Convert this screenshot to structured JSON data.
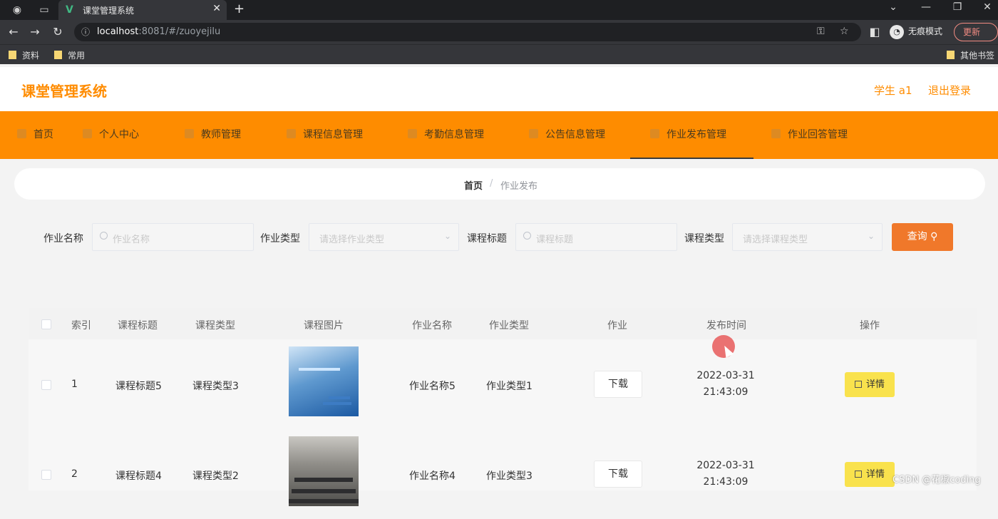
{
  "browser": {
    "tab_title": "课堂管理系统",
    "url_host": "localhost",
    "url_rest": ":8081/#/zuoyejilu",
    "incognito_label": "无痕模式",
    "update_label": "更新",
    "bookmarks": [
      "资料",
      "常用"
    ],
    "other_bookmarks": "其他书签"
  },
  "app": {
    "title": "课堂管理系统",
    "user": "学生 a1",
    "logout": "退出登录"
  },
  "menu": [
    {
      "label": "首页"
    },
    {
      "label": "个人中心"
    },
    {
      "label": "教师管理"
    },
    {
      "label": "课程信息管理"
    },
    {
      "label": "考勤信息管理"
    },
    {
      "label": "公告信息管理"
    },
    {
      "label": "作业发布管理"
    },
    {
      "label": "作业回答管理"
    }
  ],
  "breadcrumb": {
    "home": "首页",
    "separator": "/",
    "current": "作业发布"
  },
  "search": {
    "homework_name_label": "作业名称",
    "homework_name_placeholder": "作业名称",
    "homework_type_label": "作业类型",
    "homework_type_placeholder": "请选择作业类型",
    "course_title_label": "课程标题",
    "course_title_placeholder": "课程标题",
    "course_type_label": "课程类型",
    "course_type_placeholder": "请选择课程类型",
    "query_label": "查询"
  },
  "table": {
    "headers": [
      "索引",
      "课程标题",
      "课程类型",
      "课程图片",
      "作业名称",
      "作业类型",
      "作业",
      "发布时间",
      "操作"
    ],
    "rows": [
      {
        "index": "1",
        "course_title": "课程标题5",
        "course_type": "课程类型3",
        "homework_name": "作业名称5",
        "homework_type": "作业类型1",
        "download": "下载",
        "date": "2022-03-31",
        "time": "21:43:09",
        "action": "详情"
      },
      {
        "index": "2",
        "course_title": "课程标题4",
        "course_type": "课程类型2",
        "homework_name": "作业名称4",
        "homework_type": "作业类型3",
        "download": "下载",
        "date": "2022-03-31",
        "time": "21:43:09",
        "action": "详情"
      }
    ]
  },
  "watermark": "CSDN @花椒coding"
}
